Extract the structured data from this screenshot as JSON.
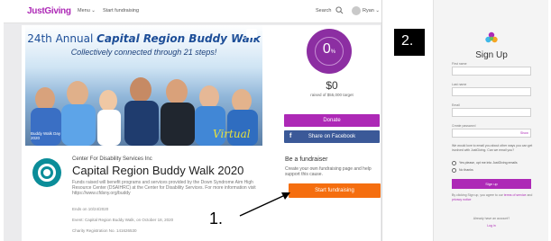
{
  "brand": {
    "logo_text": "JustGiving",
    "purple": "#ad29b6",
    "orange": "#f56e0f",
    "facebook": "#3b5998",
    "teal": "#0b8d99"
  },
  "nav": {
    "menu_label": "Menu ⌄",
    "start_label": "Start fundraising",
    "search_label": "Search",
    "search_icon": "search-icon",
    "user_label": "Ryan ⌄"
  },
  "hero": {
    "title_prefix": "24th Annual ",
    "title_emph": "Capital Region Buddy Walk",
    "subtitle": "Collectively connected through 21 steps!",
    "badge": "Virtual",
    "caption": "Buddy Walk Day 2020"
  },
  "progress": {
    "percent_value": "0",
    "percent_sign": "%",
    "fraction": 0,
    "raised": "$0",
    "target_text": "raised of $55,000 target"
  },
  "actions": {
    "donate_label": "Donate",
    "facebook_label": "Share on Facebook",
    "facebook_icon": "f"
  },
  "fundraiser": {
    "heading": "Be a fundraiser",
    "description": "Create your own fundraising page and help support this cause.",
    "start_label": "Start fundraising"
  },
  "org": {
    "name": "Center For Disability Services Inc",
    "title": "Capital Region Buddy Walk 2020",
    "description": "Funds raised will benefit programs and services provided by the Down Syndrome Aim High Resource Center (DSAIHRC) at the Center for Disability Services. For more information visit https://www.cfdsny.org/buddy",
    "meta_status": "Ends on 10/24/2020",
    "meta_event": "Event: Capital Region Buddy Walk, on October 18, 2020",
    "meta_charity": "Charity Registration No. 141626530"
  },
  "steps": {
    "step1": "1.",
    "step2": "2."
  },
  "signup": {
    "logo_icon": "justgiving-logo-icon",
    "title": "Sign Up",
    "first_name_label": "First name",
    "last_name_label": "Last name",
    "email_label": "Email",
    "password_label": "Create password",
    "show_label": "Show",
    "marketing_note": "We would love to email you about other ways you can get involved with JustGiving. Can we email you?",
    "opt_yes": "Yes please, opt me into JustGiving emails",
    "opt_no": "No thanks",
    "submit_label": "Sign up",
    "terms_prefix": "By clicking Sign up, you agree to our ",
    "terms_link": "terms of service",
    "terms_and": " and ",
    "privacy_link": "privacy notice",
    "have_account": "Already have an account?",
    "login_label": "Log in"
  }
}
